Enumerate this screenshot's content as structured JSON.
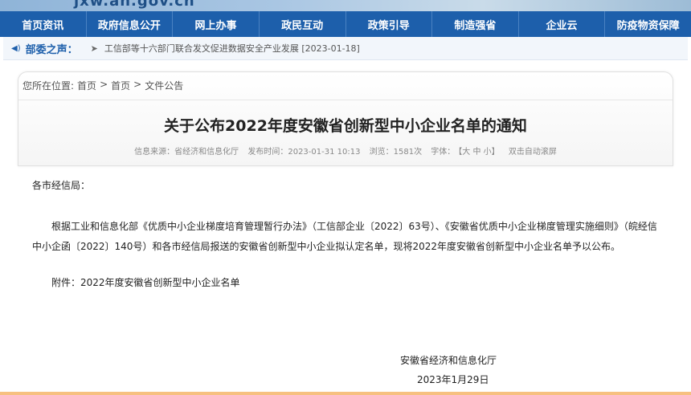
{
  "header": {
    "domain_text": "jxw.ah.gov.cn"
  },
  "nav": {
    "items": [
      "首页资讯",
      "政府信息公开",
      "网上办事",
      "政民互动",
      "政策引导",
      "制造强省",
      "企业云",
      "防疫物资保障"
    ]
  },
  "notice": {
    "label": "部委之声：",
    "link": "工信部等十六部门联合发文促进数据安全产业发展 [2023-01-18]"
  },
  "breadcrumb": {
    "prefix": "您所在位置:",
    "items": [
      "首页",
      "首页",
      "文件公告"
    ],
    "separator": ">"
  },
  "article": {
    "title": "关于公布2022年度安徽省创新型中小企业名单的通知",
    "source": "信息来源：省经济和信息化厅",
    "publish_time": "发布时间：2023-01-31 10:13",
    "views": "浏览：1581次",
    "font_label": "字体：",
    "font_sizes": "【大 中 小】",
    "auto_scroll": "双击自动滚屏",
    "salutation": "各市经信局：",
    "body": "根据工业和信息化部《优质中小企业梯度培育管理暂行办法》（工信部企业〔2022〕63号）、《安徽省优质中小企业梯度管理实施细则》（皖经信中小企函〔2022〕140号）和各市经信局报送的安徽省创新型中小企业拟认定名单，现将2022年度安徽省创新型中小企业名单予以公布。",
    "attachment": "附件：2022年度安徽省创新型中小企业名单",
    "signature_org": "安徽省经济和信息化厅",
    "signature_date": "2023年1月29日"
  },
  "colors": {
    "nav_bg": "#1d5fab",
    "accent": "#1d5fab"
  }
}
